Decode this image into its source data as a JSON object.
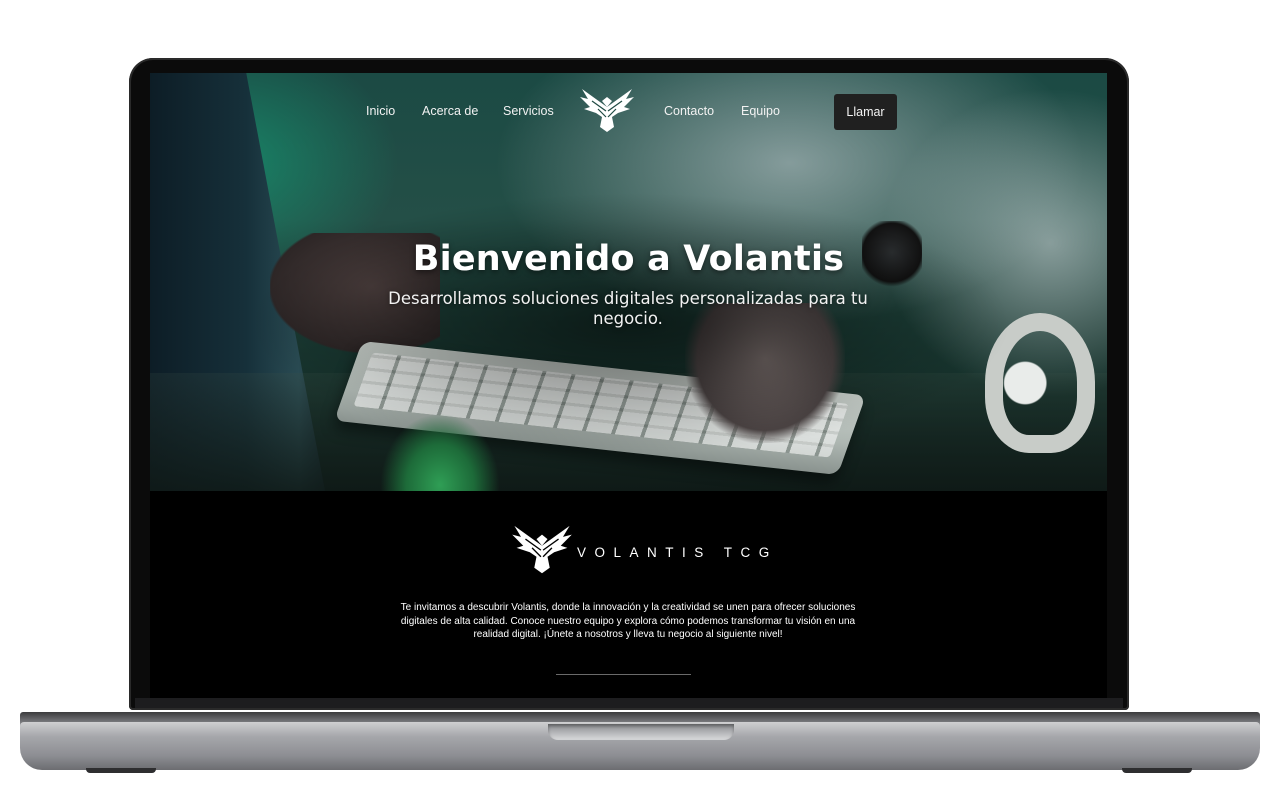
{
  "nav": {
    "items_left": [
      "Inicio",
      "Acerca de",
      "Servicios"
    ],
    "items_right": [
      "Contacto",
      "Equipo"
    ],
    "cta_label": "Llamar",
    "logo_icon": "eagle-logo-icon"
  },
  "hero": {
    "title": "Bienvenido a Volantis",
    "subtitle": "Desarrollamos soluciones digitales personalizadas para tu negocio."
  },
  "about": {
    "logo_icon": "eagle-logo-icon",
    "brand": "VOLANTIS TCG",
    "text": "Te invitamos a descubrir Volantis, donde la innovación y la creatividad se unen para ofrecer soluciones digitales de alta calidad. Conoce nuestro equipo y explora cómo podemos transformar tu visión en una realidad digital. ¡Únete a nosotros y lleva tu negocio al siguiente nivel!"
  },
  "colors": {
    "hero_tint": "#1f4a43",
    "section_bg": "#000000",
    "cta_bg": "#202020",
    "text": "#ffffff"
  }
}
